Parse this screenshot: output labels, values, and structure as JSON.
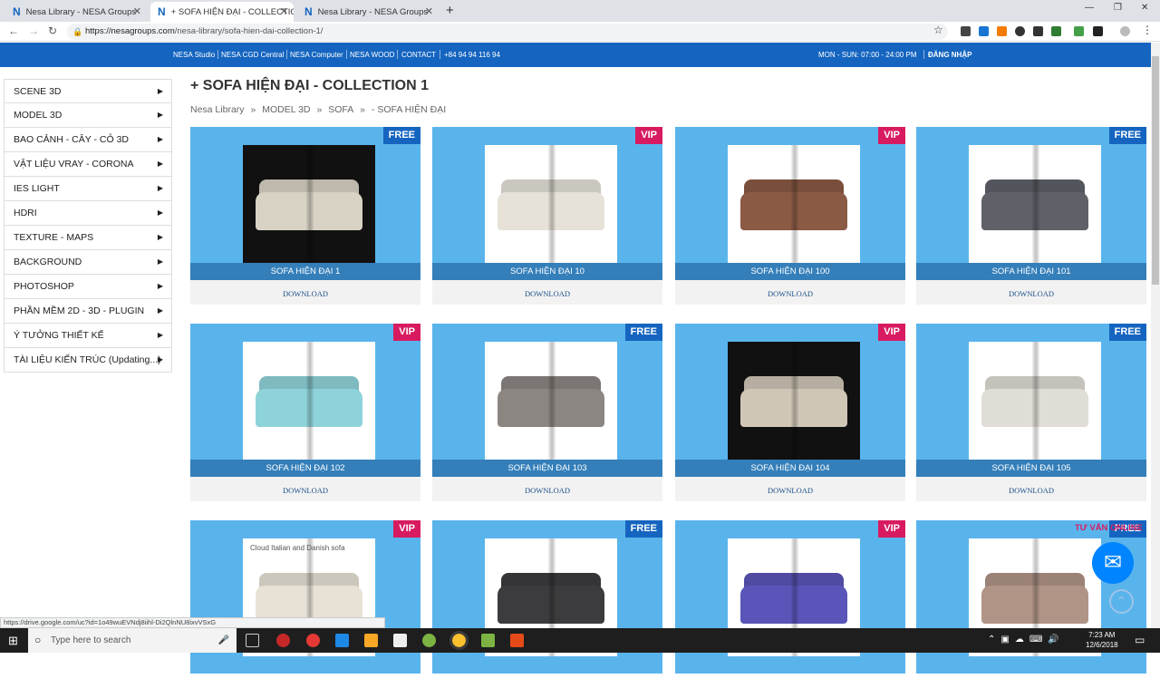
{
  "browser": {
    "tabs": [
      {
        "label": "Nesa Library - NESA Groups",
        "favicon": "N"
      },
      {
        "label": "+ SOFA HIỆN ĐẠI - COLLECTION",
        "favicon": "N"
      },
      {
        "label": "Nesa Library - NESA Groups",
        "favicon": "N"
      }
    ],
    "url_host": "https://nesagroups.com",
    "url_path": "/nesa-library/sofa-hien-dai-collection-1/"
  },
  "site_nav": {
    "links": [
      "NESA Studio",
      "NESA CGD Central",
      "NESA Computer",
      "NESA WOOD",
      "CONTACT",
      "+84 94 94 116 94"
    ],
    "hours": "MON - SUN: 07:00 - 24:00 PM",
    "login": "ĐĂNG NHẬP"
  },
  "sidebar": {
    "items": [
      {
        "label": "SCENE 3D"
      },
      {
        "label": "MODEL 3D"
      },
      {
        "label": "BAO CẢNH - CÂY - CỎ 3D"
      },
      {
        "label": "VẬT LIỆU VRAY - CORONA"
      },
      {
        "label": "IES LIGHT"
      },
      {
        "label": "HDRI"
      },
      {
        "label": "TEXTURE - MAPS"
      },
      {
        "label": "BACKGROUND"
      },
      {
        "label": "PHOTOSHOP"
      },
      {
        "label": "PHẦN MỀM 2D - 3D - PLUGIN"
      },
      {
        "label": "Ý TƯỞNG THIẾT KẾ"
      },
      {
        "label": "TÀI LIỆU KIẾN TRÚC (Updating...)"
      }
    ]
  },
  "main": {
    "title": "+ SOFA HIỆN ĐẠI - COLLECTION 1",
    "breadcrumb": [
      "Nesa Library",
      "»",
      "MODEL 3D",
      "»",
      "SOFA",
      "»",
      "- SOFA HIỆN ĐẠI"
    ],
    "download_label": "DOWNLOAD",
    "cards": [
      {
        "name": "SOFA HIỆN ĐẠI 1",
        "badge": "FREE",
        "dark": true,
        "sofa": "#d8d2c4"
      },
      {
        "name": "SOFA HIỆN ĐẠI 10",
        "badge": "VIP",
        "dark": false,
        "sofa": "#e6e2d8"
      },
      {
        "name": "SOFA HIỆN ĐẠI 100",
        "badge": "VIP",
        "dark": false,
        "sofa": "#8a5a44"
      },
      {
        "name": "SOFA HIỆN ĐẠI 101",
        "badge": "FREE",
        "dark": false,
        "sofa": "#5e6168"
      },
      {
        "name": "SOFA HIỆN ĐẠI 102",
        "badge": "VIP",
        "dark": false,
        "sofa": "#8fd3da"
      },
      {
        "name": "SOFA HIỆN ĐẠI 103",
        "badge": "FREE",
        "dark": false,
        "sofa": "#8c8683"
      },
      {
        "name": "SOFA HIỆN ĐẠI 104",
        "badge": "VIP",
        "dark": true,
        "sofa": "#cfc6b6"
      },
      {
        "name": "SOFA HIỆN ĐẠI 105",
        "badge": "FREE",
        "dark": false,
        "sofa": "#e0ddd6"
      },
      {
        "name": "",
        "badge": "VIP",
        "dark": false,
        "sofa": "#e8e2d6"
      },
      {
        "name": "",
        "badge": "FREE",
        "dark": false,
        "sofa": "#3c3c3e"
      },
      {
        "name": "",
        "badge": "VIP",
        "dark": false,
        "sofa": "#5a55b8"
      },
      {
        "name": "",
        "badge": "FREE",
        "dark": false,
        "sofa": "#b09486"
      }
    ],
    "card_overlay_text": "Cloud Italian and Danish sofa"
  },
  "floating": {
    "tuvan": "TƯ VẤN ONLINE"
  },
  "status_url": "https://drive.google.com/uc?id=1o49wuEVNdj8iihl-Di2QlnNU8ixvVSxG",
  "taskbar": {
    "search_placeholder": "Type here to search",
    "time": "7:23 AM",
    "date": "12/6/2018"
  },
  "colors": {
    "brand_blue": "#1565c0",
    "vip": "#d81b60",
    "card_bg": "#5ab4ec"
  }
}
